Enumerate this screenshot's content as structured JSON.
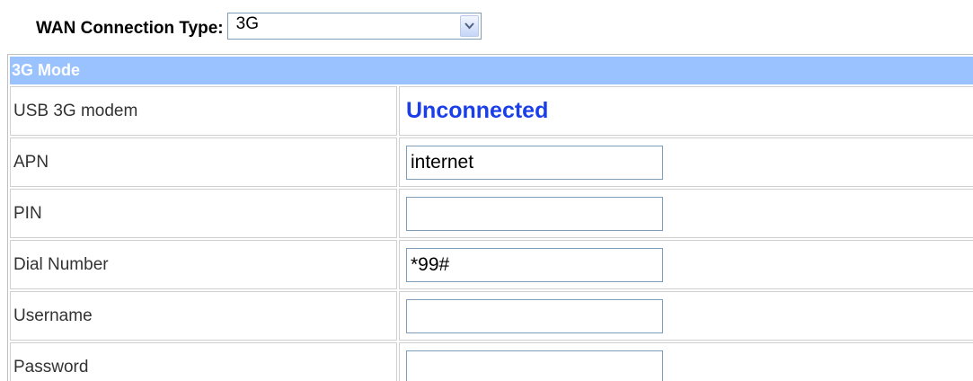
{
  "wan": {
    "label": "WAN Connection Type:",
    "selected": "3G"
  },
  "section": {
    "title": "3G Mode"
  },
  "rows": {
    "modem": {
      "label": "USB 3G modem",
      "status": "Unconnected"
    },
    "apn": {
      "label": "APN",
      "value": "internet"
    },
    "pin": {
      "label": "PIN",
      "value": ""
    },
    "dial": {
      "label": "Dial Number",
      "value": "*99#"
    },
    "username": {
      "label": "Username",
      "value": ""
    },
    "password": {
      "label": "Password",
      "value": ""
    }
  },
  "colors": {
    "section_header_bg": "#99c2ff",
    "status_text": "#1a3fe8"
  },
  "icons": {
    "dropdown": "chevron-down-icon"
  }
}
